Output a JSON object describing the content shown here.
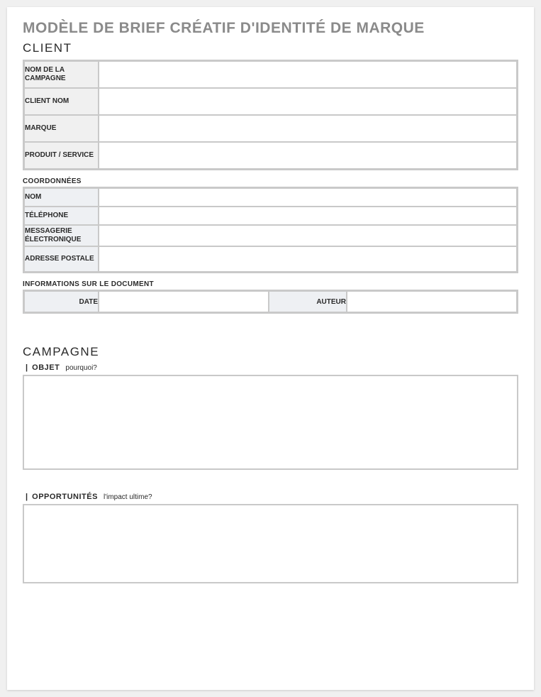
{
  "document": {
    "title": "MODÈLE DE BRIEF CRÉATIF D'IDENTITÉ DE MARQUE"
  },
  "client_section": {
    "title": "CLIENT",
    "rows": {
      "campaign_name_label": "NOM DE LA CAMPAGNE",
      "campaign_name_value": "",
      "client_name_label": "CLIENT NOM",
      "client_name_value": "",
      "brand_label": "MARQUE",
      "brand_value": "",
      "product_service_label": "PRODUIT / SERVICE",
      "product_service_value": ""
    }
  },
  "contact_section": {
    "title": "COORDONNÉES",
    "rows": {
      "name_label": "NOM",
      "name_value": "",
      "phone_label": "TÉLÉPHONE",
      "phone_value": "",
      "email_label": "MESSAGERIE ÉLECTRONIQUE",
      "email_value": "",
      "postal_label": "ADRESSE POSTALE",
      "postal_value": ""
    }
  },
  "docinfo_section": {
    "title": "INFORMATIONS SUR LE DOCUMENT",
    "date_label": "DATE",
    "date_value": "",
    "author_label": "AUTEUR",
    "author_value": ""
  },
  "campaign_section": {
    "title": "CAMPAGNE",
    "object_label": "OBJET",
    "object_hint": "pourquoi?",
    "object_value": "",
    "opportunities_label": "OPPORTUNITÉS",
    "opportunities_hint": "l'impact ultime?",
    "opportunities_value": ""
  }
}
